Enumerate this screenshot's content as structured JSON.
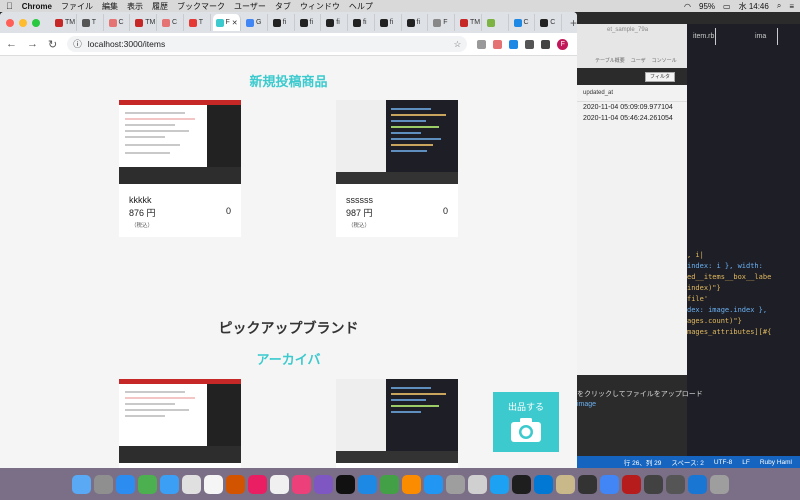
{
  "menubar": {
    "app": "Chrome",
    "items": [
      "ファイル",
      "編集",
      "表示",
      "履歴",
      "ブックマーク",
      "ユーザー",
      "タブ",
      "ウィンドウ",
      "ヘルプ"
    ],
    "battery": "95%",
    "clock": "水 14:46"
  },
  "browser": {
    "url": "localhost:3000/items",
    "tabs": [
      "TM",
      "T",
      "C",
      "TM",
      "C",
      "T",
      "F",
      "G",
      "fi",
      "fi",
      "fi",
      "fi",
      "fi",
      "fi",
      "F",
      "TM",
      "C",
      "C"
    ],
    "active_tab_label": "F",
    "profile_initial": "F"
  },
  "page": {
    "new_items_title": "新規投稿商品",
    "pickup_brand_title": "ピックアップブランド",
    "archive_title": "アーカイバ",
    "items": [
      {
        "name": "kkkkk",
        "price": "876 円",
        "tax": "（税込）",
        "likes": "0"
      },
      {
        "name": "ssssss",
        "price": "987 円",
        "tax": "（税込）",
        "likes": "0"
      }
    ],
    "sell_button_label": "出品する"
  },
  "background": {
    "editor_tab": "item.rb",
    "editor_tab2": "ima",
    "filter_button": "フィルタ",
    "toolbar_labels": [
      "テーブル概要",
      "ユーザ",
      "コンソール"
    ],
    "column_header": "updated_at",
    "rows": [
      "2020-11-04 05:09:09.977104",
      "2020-11-04 05:46:24.261054"
    ],
    "code_lines": [
      ", i|",
      "index: i }, width:",
      "ed__items__box__labe",
      "index)\"}",
      "file'",
      "dex: image.index },",
      "ages.count)\"}",
      "mages_attributes][#{"
    ],
    "bottom_text": "をクリックしてファイルをアップロード",
    "bottom_text2": "image",
    "status": [
      "行 26、列 29",
      "スペース: 2",
      "UTF-8",
      "LF",
      "Ruby Haml"
    ],
    "window_title": "et_sample_79a"
  }
}
